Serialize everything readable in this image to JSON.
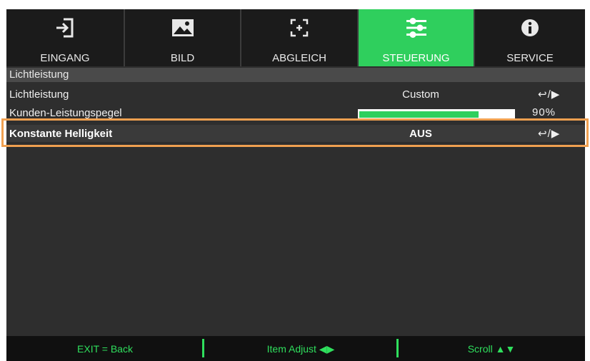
{
  "tabs": [
    {
      "label": "EINGANG",
      "icon": "input-icon",
      "active": false
    },
    {
      "label": "BILD",
      "icon": "image-icon",
      "active": false
    },
    {
      "label": "ABGLEICH",
      "icon": "alignment-icon",
      "active": false
    },
    {
      "label": "STEUERUNG",
      "icon": "sliders-icon",
      "active": true
    },
    {
      "label": "SERVICE",
      "icon": "info-icon",
      "active": false
    }
  ],
  "section": {
    "title": "Lichtleistung"
  },
  "rows": [
    {
      "name": "Lichtleistung",
      "value": "Custom",
      "action": "↩/▶"
    },
    {
      "name": "Kunden-Leistungspegel",
      "value": "90%",
      "level": 0.9
    },
    {
      "name": "Konstante Helligkeit",
      "value": "AUS",
      "action": "↩/▶"
    }
  ],
  "footer": {
    "exit": "EXIT = Back",
    "adjust": "Item Adjust ◀▶",
    "scroll": "Scroll ▲▼"
  },
  "colors": {
    "accent": "#2fcf5d",
    "highlight": "#f0a050",
    "panel": "#2e2e2e",
    "tab": "#1b1b1b"
  }
}
